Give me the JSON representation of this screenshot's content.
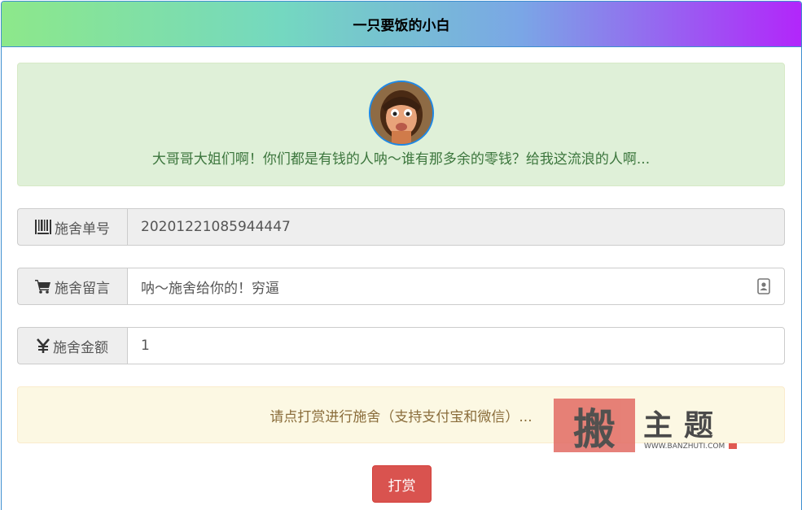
{
  "panel": {
    "title": "一只要饭的小白"
  },
  "greeting": {
    "message": "大哥哥大姐们啊！你们都是有钱的人呐～谁有那多余的零钱？给我这流浪的人啊..."
  },
  "order": {
    "label": "施舍单号",
    "value": "20201221085944447",
    "icon": "barcode-icon"
  },
  "message": {
    "label": "施舍留言",
    "value": "呐～施舍给你的！穷逼",
    "icon": "cart-icon",
    "suffix_icon": "contact-card-icon"
  },
  "amount": {
    "label": "施舍金额",
    "value": "1",
    "icon": "yen-icon"
  },
  "notice": {
    "text": "请点打赏进行施舍（支持支付宝和微信）..."
  },
  "donate_button": {
    "label": "打赏"
  },
  "watermark": {
    "glyph": "搬",
    "title": "主题",
    "url": "WWW.BANZHUTI.COM"
  },
  "colors": {
    "header_gradient": [
      "#8de88a",
      "#74d8c0",
      "#7aa6e6",
      "#b226fa"
    ],
    "success_bg": "#dff0d8",
    "warning_bg": "#fcf8e3",
    "danger": "#d9534f",
    "primary_border": "#3e8ed0"
  }
}
